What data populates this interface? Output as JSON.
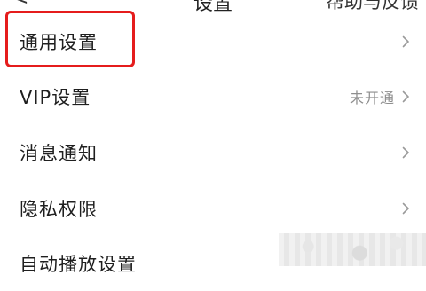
{
  "header": {
    "back_glyph": "<",
    "title": "设置",
    "action_label": "帮助与反馈"
  },
  "settings": {
    "items": [
      {
        "label": "通用设置",
        "value": ""
      },
      {
        "label": "VIP设置",
        "value": "未开通"
      },
      {
        "label": "消息通知",
        "value": ""
      },
      {
        "label": "隐私权限",
        "value": ""
      },
      {
        "label": "自动播放设置",
        "value": ""
      }
    ]
  },
  "colors": {
    "highlight": "#e51c1c",
    "chevron": "#9a9a9a",
    "secondary_text": "#8e8e8e"
  },
  "icons": {
    "chevron": "chevron-right-icon"
  }
}
